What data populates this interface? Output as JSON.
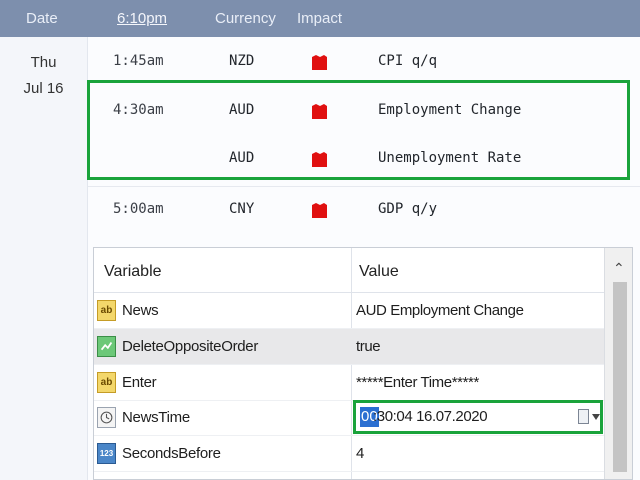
{
  "calendar": {
    "header": {
      "date": "Date",
      "time": "6:10pm",
      "currency": "Currency",
      "impact": "Impact"
    },
    "day": {
      "name": "Thu",
      "date": "Jul 16"
    },
    "impact_color": "#e01010",
    "events": [
      {
        "time": "1:45am",
        "currency": "NZD",
        "impact": "high-impact-icon",
        "name": "CPI q/q"
      },
      {
        "time": "4:30am",
        "currency": "AUD",
        "impact": "high-impact-icon",
        "name": "Employment Change"
      },
      {
        "time": "",
        "currency": "AUD",
        "impact": "high-impact-icon",
        "name": "Unemployment Rate"
      },
      {
        "time": "5:00am",
        "currency": "CNY",
        "impact": "high-impact-icon",
        "name": "GDP q/y"
      }
    ]
  },
  "properties": {
    "columns": {
      "variable": "Variable",
      "value": "Value"
    },
    "rows": [
      {
        "icon": "string-icon",
        "name": "News",
        "value": "AUD Employment Change"
      },
      {
        "icon": "bool-icon",
        "name": "DeleteOppositeOrder",
        "value": "true"
      },
      {
        "icon": "string-icon",
        "name": "Enter",
        "value": "*****Enter Time*****"
      },
      {
        "icon": "datetime-icon",
        "name": "NewsTime",
        "value": ""
      },
      {
        "icon": "integer-icon",
        "name": "SecondsBefore",
        "value": "4"
      }
    ],
    "news_time_editor": {
      "selected": "00",
      "rest": ":30:04 16.07.2020"
    },
    "icon_labels": {
      "string": "ab",
      "integer": "123"
    }
  },
  "highlight_color": "#1aa33b"
}
